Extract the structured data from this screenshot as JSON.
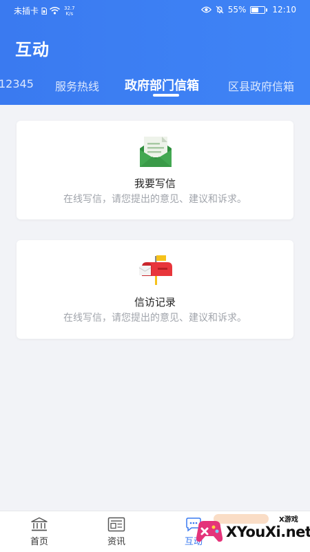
{
  "status_bar": {
    "carrier": "未插卡",
    "speed_value": "32.7",
    "speed_unit": "K/s",
    "battery": "55%",
    "battery_level": 0.55,
    "time": "12:10"
  },
  "header": {
    "title": "互动",
    "tabs": [
      {
        "label": "12345"
      },
      {
        "label": "服务热线"
      },
      {
        "label": "政府部门信箱",
        "active": true
      },
      {
        "label": "区县政府信箱"
      }
    ]
  },
  "cards": [
    {
      "title": "我要写信",
      "description": "在线写信，请您提出的意见、建议和诉求。",
      "icon": "envelope-icon"
    },
    {
      "title": "信访记录",
      "description": "在线写信，请您提出的意见、建议和诉求。",
      "icon": "mailbox-icon"
    }
  ],
  "bottom_nav": [
    {
      "label": "首页",
      "icon": "bank-icon"
    },
    {
      "label": "资讯",
      "icon": "news-icon"
    },
    {
      "label": "互动",
      "icon": "chat-icon",
      "active": true
    }
  ],
  "watermark": {
    "text": "XYouXi.net",
    "small": "X游戏"
  },
  "colors": {
    "header_blue": "#3a7af0",
    "background": "#f2f3f7",
    "envelope_green": "#3fa34d",
    "mailbox_red": "#e8353b",
    "flag_yellow": "#f6c21b"
  }
}
